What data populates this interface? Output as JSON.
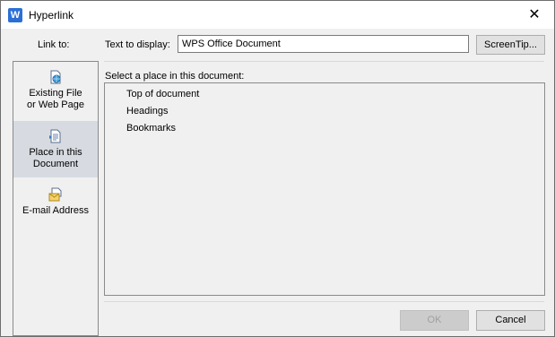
{
  "window": {
    "title": "Hyperlink",
    "close_glyph": "✕"
  },
  "link_to": {
    "label": "Link to:",
    "items": [
      {
        "label_line1": "Existing File",
        "label_line2": "or Web Page",
        "icon": "web-page-icon",
        "selected": false
      },
      {
        "label_line1": "Place in this",
        "label_line2": "Document",
        "icon": "document-place-icon",
        "selected": true
      },
      {
        "label_line1": "E-mail Address",
        "label_line2": "",
        "icon": "email-icon",
        "selected": false
      }
    ]
  },
  "text_to_display": {
    "label": "Text to display:",
    "value": "WPS Office Document"
  },
  "screentip_button": "ScreenTip...",
  "place_section": {
    "label": "Select a place in this document:",
    "items": [
      "Top of document",
      "Headings",
      "Bookmarks"
    ]
  },
  "ok_button": "OK",
  "cancel_button": "Cancel",
  "colors": {
    "app_icon": "#2b6fd6",
    "selected_item": "#d7dbe1",
    "window_bg": "#f0f0f0"
  }
}
